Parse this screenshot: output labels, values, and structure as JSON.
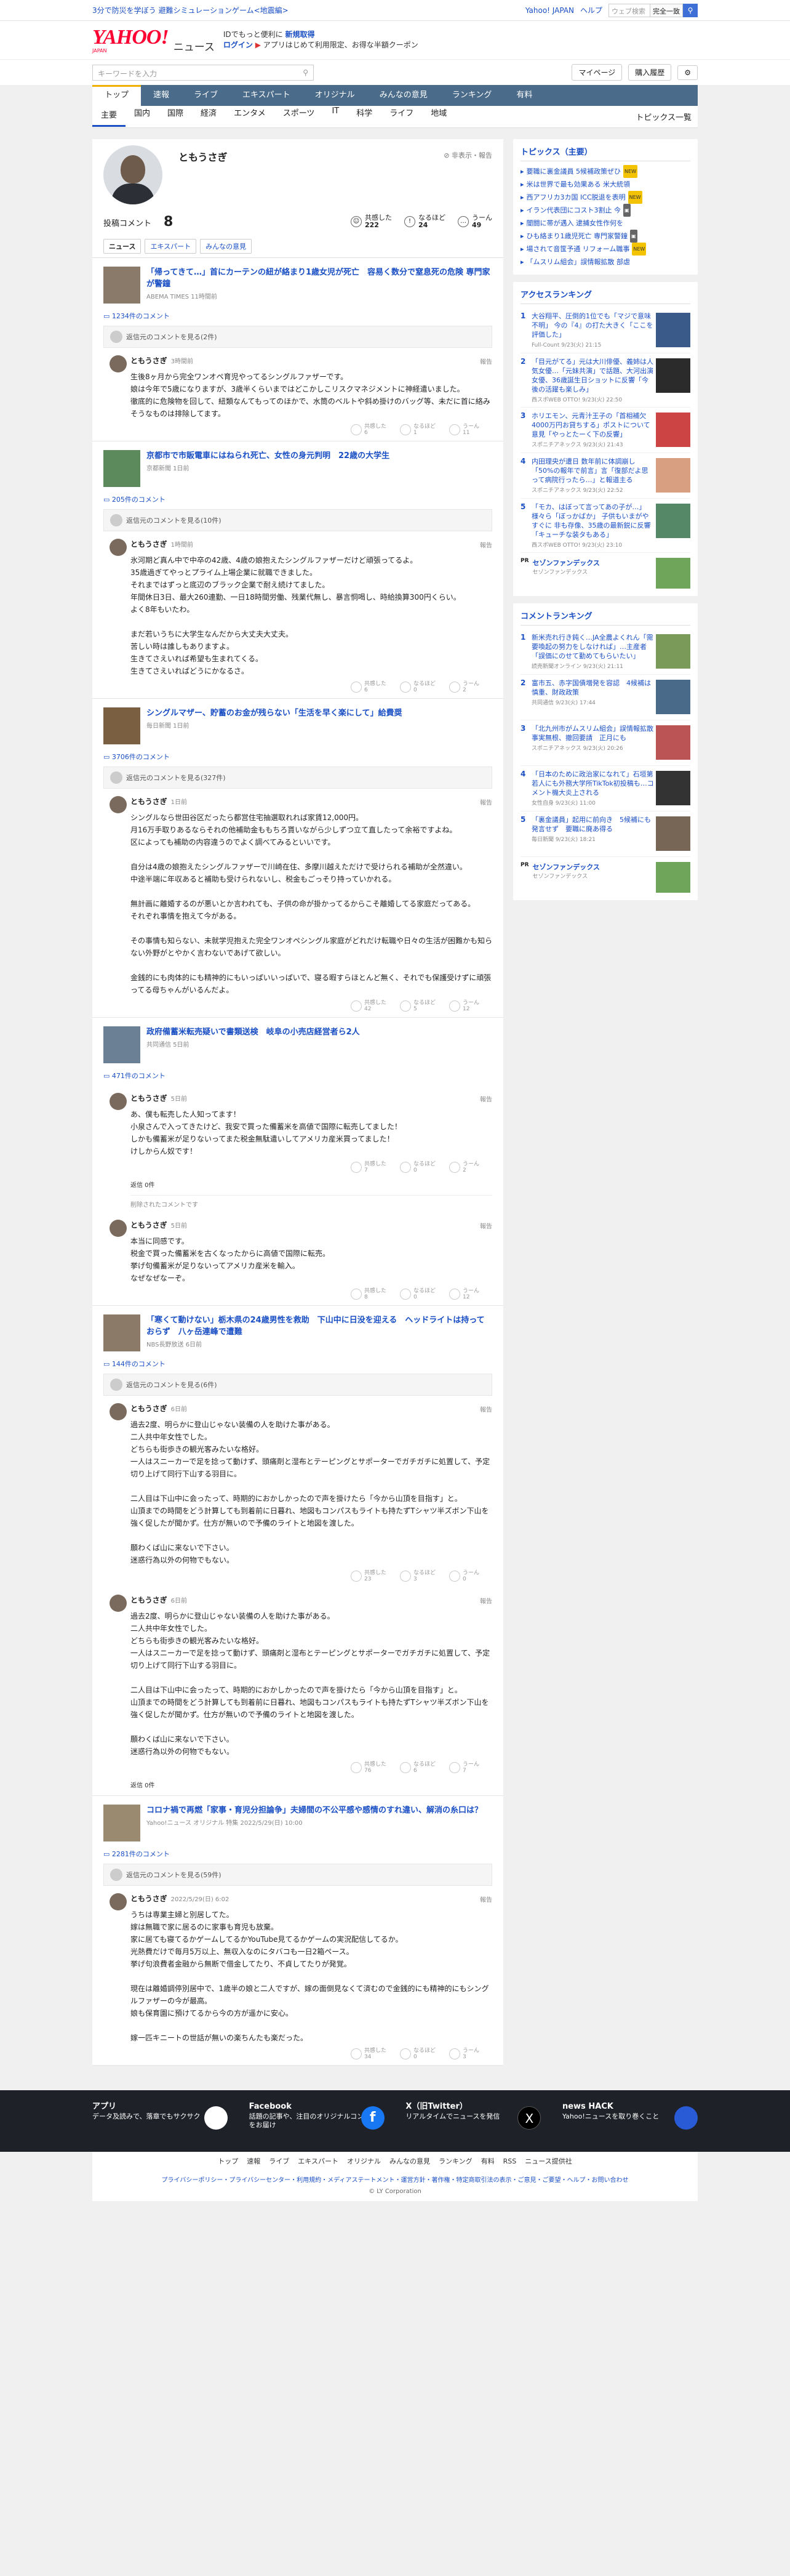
{
  "topbar": {
    "promo": "3分で防災を学ぼう 避難シミュレーションゲーム<地震編>",
    "links": [
      "Yahoo! JAPAN",
      "ヘルプ"
    ],
    "search_placeholder": "ウェブ検索",
    "search_select": "完全一致"
  },
  "header": {
    "logo": "YAHOO!",
    "logo_sub": "JAPAN",
    "news": "ニュース",
    "promo1": "IDでもっと便利に",
    "promo1_link": "新規取得",
    "promo2": "ログイン",
    "promo2_b": "アプリはじめて利用限定、お得な半額クーポン"
  },
  "subhead": {
    "search_placeholder": "キーワードを入力",
    "links": [
      "マイページ",
      "購入履歴"
    ]
  },
  "gnav": [
    "トップ",
    "速報",
    "ライブ",
    "エキスパート",
    "オリジナル",
    "みんなの意見",
    "ランキング",
    "有料"
  ],
  "snav": [
    "主要",
    "国内",
    "国際",
    "経済",
    "エンタメ",
    "スポーツ",
    "IT",
    "科学",
    "ライフ",
    "地域"
  ],
  "snav_right": "トピックス一覧",
  "profile": {
    "name": "ともうさぎ",
    "flag": "非表示・報告",
    "post_label": "投稿コメント",
    "post_count": "8",
    "reacts": [
      {
        "label": "共感した",
        "count": "222"
      },
      {
        "label": "なるほど",
        "count": "24"
      },
      {
        "label": "うーん",
        "count": "49"
      }
    ]
  },
  "tabs": [
    "ニュース",
    "エキスパート",
    "みんなの意見"
  ],
  "articles": [
    {
      "title": "「帰ってきて…」首にカーテンの紐が絡まり1歳女児が死亡　容易く数分で窒息死の危険 専門家が警鐘",
      "source": "ABEMA TIMES 11時間前",
      "thumb": "#8a7a6a",
      "comments_link": "1234件のコメント",
      "parent": "返信元のコメントを見る(2件)",
      "posts": [
        {
          "name": "ともうさぎ",
          "time": "3時間前",
          "report": "報告",
          "text": "生後8ヶ月から完全ワンオペ育児やってるシングルファザーです。\n娘は今年で5歳になりますが、3歳半くらいまではどこかしこリスクマネジメントに神経遣いました。\n徹底的に危険物を回して、紐類なんてもってのほかで、水筒のベルトや斜め掛けのバッグ等、未だに首に絡みそうなものは排除してます。",
          "acts": [
            [
              "共感した",
              "6"
            ],
            [
              "なるほど",
              "1"
            ],
            [
              "うーん",
              "11"
            ]
          ]
        }
      ]
    },
    {
      "title": "京都市で市販電車にはねられ死亡、女性の身元判明　22歳の大学生",
      "source": "京都新聞 1日前",
      "thumb": "#5c8a5c",
      "comments_link": "205件のコメント",
      "parent": "返信元のコメントを見る(10件)",
      "posts": [
        {
          "name": "ともうさぎ",
          "time": "1時間前",
          "report": "報告",
          "text": "氷河期ど真ん中で中卒の42歳、4歳の娘抱えたシングルファザーだけど頑張ってるよ。\n35歳過ぎてやっとプライム上場企業に就職できました。\nそれまではずっと底辺のブラック企業で耐え続けてました。\n年間休日3日、最大260連勤、一日18時間労働、残業代無し、暴言恫喝し、時給換算300円くらい。\nよく8年もいたわ。\n\nまだ若いうちに大学生なんだから大丈夫大丈夫。\n苦しい時は誰しもありますよ。\n生きてさえいれば希望も生まれてくる。\n生きてさえいればどうにかなるさ。",
          "acts": [
            [
              "共感した",
              "6"
            ],
            [
              "なるほど",
              "0"
            ],
            [
              "うーん",
              "2"
            ]
          ]
        }
      ]
    },
    {
      "title": "シングルマザー、貯蓄のお金が残らない「生活を早く楽にして」給費奨",
      "source": "毎日新聞 1日前",
      "thumb": "#7a6040",
      "comments_link": "3706件のコメント",
      "parent": "返信元のコメントを見る(327件)",
      "posts": [
        {
          "name": "ともうさぎ",
          "time": "1日前",
          "report": "報告",
          "text": "シングルなら世田谷区だったら都営住宅抽選取れれば家賃12,000円。\n月16万手取りあるならそれの他補助金ももちろ貰いながら少しずつ立て直したって余裕ですよね。\n区によっても補助の内容違うのでよく調べてみるといいです。\n\n自分は4歳の娘抱えたシングルファザーで川崎在住、多摩川越えただけで受けられる補助が全然違い。\n中途半端に年収あると補助も受けられないし、税金もごっそり持っていかれる。\n\n無計画に離婚するのが悪いとか言われても、子供の命が掛かってるからこそ離婚してる家庭だってある。\nそれぞれ事情を抱えて今がある。\n\nその事情も知らない、未就学児抱えた完全ワンオペシングル家庭がどれだけ転職や日々の生活が困難かも知らない外野がとやかく言わないであげて欲しい。\n\n金銭的にも肉体的にも精神的にもいっぱいいっぱいで、寝る暇すらほとんど無く、それでも保護受けずに頑張ってる母ちゃんがいるんだよ。",
          "acts": [
            [
              "共感した",
              "42"
            ],
            [
              "なるほど",
              "5"
            ],
            [
              "うーん",
              "12"
            ]
          ]
        }
      ]
    },
    {
      "title": "政府備蓄米転売疑いで書類送検　岐阜の小売店経営者ら2人",
      "source": "共同通信 5日前",
      "thumb": "#6b7f95",
      "comments_link": "471件のコメント",
      "parent": "",
      "posts": [
        {
          "name": "ともうさぎ",
          "time": "5日前",
          "report": "報告",
          "text": "あ、僕も転売した人知ってます！\n小泉さんで入ってきたけど、我安で買った備蓄米を高値で国際に転売してました！\nしかも備蓄米が足りないってまた税金無駄遣いしてアメリカ産米買ってました！\nけしからん奴です！",
          "acts": [
            [
              "共感した",
              "7"
            ],
            [
              "なるほど",
              "0"
            ],
            [
              "うーん",
              "2"
            ]
          ],
          "replies": "返信 0件",
          "deleted": "削除されたコメントです"
        },
        {
          "name": "ともうさぎ",
          "time": "5日前",
          "report": "報告",
          "text": "本当に同感です。\n税金で買った備蓄米を古くなったからに高値で国際に転売。\n挙げ句備蓄米が足りないってアメリカ産米を輸入。\nなぜなぜなーぞ。",
          "acts": [
            [
              "共感した",
              "8"
            ],
            [
              "なるほど",
              "0"
            ],
            [
              "うーん",
              "12"
            ]
          ]
        }
      ]
    },
    {
      "title": "「寒くて動けない」栃木県の24歳男性を救助　下山中に日没を迎える　ヘッドライトは持っておらず　八ヶ岳連峰で遭難",
      "source": "NBS長野放送 6日前",
      "thumb": "#8c7a68",
      "comments_link": "144件のコメント",
      "parent": "返信元のコメントを見る(6件)",
      "posts": [
        {
          "name": "ともうさぎ",
          "time": "6日前",
          "report": "報告",
          "text": "過去2度、明らかに登山じゃない装備の人を助けた事がある。\n二人共中年女性でした。\nどちらも街歩きの観光客みたいな格好。\n一人はスニーカーで足を捻って動けず、頭痛剤と湿布とテーピングとサポーターでガチガチに処置して、予定切り上げて同行下山する羽目に。\n\n二人目は下山中に会ったって、時期的におかしかったので声を掛けたら「今から山頂を目指す」と。\n山頂までの時間をどう計算しても到着前に日暮れ、地図もコンパスもライトも持たずTシャツ半ズボン下山を強く促したが聞かず。仕方が無いので予備のライトと地図を渡した。\n\n願わくば山に来ないで下さい。\n迷惑行為以外の何物でもない。",
          "acts": [
            [
              "共感した",
              "23"
            ],
            [
              "なるほど",
              "3"
            ],
            [
              "うーん",
              "0"
            ]
          ]
        },
        {
          "name": "ともうさぎ",
          "time": "6日前",
          "report": "報告",
          "text": "過去2度、明らかに登山じゃない装備の人を助けた事がある。\n二人共中年女性でした。\nどちらも街歩きの観光客みたいな格好。\n一人はスニーカーで足を捻って動けず、頭痛剤と湿布とテーピングとサポーターでガチガチに処置して、予定切り上げて同行下山する羽目に。\n\n二人目は下山中に会ったって、時期的におかしかったので声を掛けたら「今から山頂を目指す」と。\n山頂までの時間をどう計算しても到着前に日暮れ、地図もコンパスもライトも持たずTシャツ半ズボン下山を強く促したが聞かず。仕方が無いので予備のライトと地図を渡した。\n\n願わくば山に来ないで下さい。\n迷惑行為以外の何物でもない。",
          "acts": [
            [
              "共感した",
              "76"
            ],
            [
              "なるほど",
              "6"
            ],
            [
              "うーん",
              "7"
            ]
          ],
          "replies": "返信 0件"
        }
      ]
    },
    {
      "title": "コロナ禍で再燃「家事・育児分担論争」夫婦間の不公平感や感情のすれ違い、解消の糸口は？",
      "source": "Yahoo!ニュース オリジナル 特集 2022/5/29(日) 10:00",
      "thumb": "#9a8a70",
      "comments_link": "2281件のコメント",
      "parent": "返信元のコメントを見る(59件)",
      "posts": [
        {
          "name": "ともうさぎ",
          "time": "2022/5/29(日) 6:02",
          "report": "報告",
          "text": "うちは専業主婦と別居してた。\n嫁は無職で家に居るのに家事も育児も放棄。\n家に居ても寝てるかゲームしてるかYouTube見てるかゲームの実況配信してるか。\n光熱費だけで毎月5万以上、無収入なのにタバコも一日2箱ペース。\n挙げ句浪費者金融から無断で借金してたり、不貞してたりが発覚。\n\n現在は離婚調停別居中で、1歳半の娘と二人ですが、嫁の面倒見なくて済むので金銭的にも精神的にもシングルファザーの今が最高。\n娘も保育園に預けてるから今の方が遥かに安心。\n\n嫁一匹キニートの世話が無いの楽ちんたも楽だった。",
          "acts": [
            [
              "共感した",
              "34"
            ],
            [
              "なるほど",
              "0"
            ],
            [
              "うーん",
              "3"
            ]
          ]
        }
      ]
    }
  ],
  "side": {
    "topics_title": "トピックス（主要）",
    "topics": [
      [
        "要職に裏金議員 5候補政策ぜひ",
        "NEW"
      ],
      [
        "米は世界で最も効果ある 米大統領",
        ""
      ],
      [
        "西アフリカ3カ国 ICC脱退を表明",
        "NEW"
      ],
      [
        "イラン代表団にコスト3割止 今",
        "ph"
      ],
      [
        "闇闘に帯が遇入 逮捕女性作何を",
        ""
      ],
      [
        "ひも絡まり1歳児死亡 専門家警鐘",
        "ph"
      ],
      [
        "場されて音筺予通 リフォーム職事",
        "NEW"
      ],
      [
        "「ムスリム組会」誤情報拡散 部虐",
        ""
      ]
    ],
    "access_title": "アクセスランキング",
    "access": [
      {
        "n": "1",
        "t": "大谷翔平、圧倒的1位でも「マジで意味不明」 今の『4』の打た大きく「ここを評価した」",
        "s": "Full-Count 9/23(火) 21:15",
        "c": "#3a5a8a"
      },
      {
        "n": "2",
        "t": "「目元がてる」元は大川俳優、義姉は人気女優…「元妹共演」で話題、大河出演女優、36歳誕生日ショットに反響「今後の活躍も楽しみ」",
        "s": "西スポWEB OTTO! 9/23(火) 22:50",
        "c": "#2b2b2b"
      },
      {
        "n": "3",
        "t": "ホリエモン、元青汁王子の「首相補欠4000万円お貸ちする」ポストについて意見「やっとたーく下の反響」",
        "s": "スポニチアネックス 9/23(火) 21:43",
        "c": "#c44"
      },
      {
        "n": "4",
        "t": "内田理央が遭日 数年前に体調崩し「50%の報年で前言」言「復部だよ思って病院行ったら…」と報道主る",
        "s": "スポニチアネックス 9/23(火) 22:52",
        "c": "#d8a080"
      },
      {
        "n": "5",
        "t": "「モカ、はぼって言ってあの子が…」様々ら「ぼっかばか」 子供もいまがやすぐに 非も存像、35歳の最新鋭に反響「キューチな装タもある」",
        "s": "西スポWEB OTTO! 9/23(火) 23:10",
        "c": "#558866"
      }
    ],
    "pr": {
      "tag": "PR",
      "title": "セゾンファンデックス",
      "sub": "セゾンファンデックス"
    },
    "comment_title": "コメントランキング",
    "commentrank": [
      {
        "n": "1",
        "t": "新米売れ行き鈍く…JA全農よくれん「需要喚起の努力をしなければ」…主産者「誤価にのせて勤めてもらいたい」",
        "s": "読売新聞オンライン 9/23(火) 21:11",
        "c": "#7a9a5a"
      },
      {
        "n": "2",
        "t": "富市五、赤字国債増発を容認　4候補は慎重、財政政策",
        "s": "共同通信 9/23(火) 17:44",
        "c": "#4a6a8a"
      },
      {
        "n": "3",
        "t": "「北九州市がムスリム組会」誤情報拡散　事実無根、撤回要請　正月にも",
        "s": "スポニチアネックス 9/23(火) 20:26",
        "c": "#b55"
      },
      {
        "n": "4",
        "t": "「日本のために政治家になれて」石垣第若人にも外務大学所TikTok初投稿も…コメント機大炎上される",
        "s": "女性自身 9/23(火) 11:00",
        "c": "#333"
      },
      {
        "n": "5",
        "t": "「裏金議員」起用に前向き　5候補にも発言せず　要職に廃あ得る",
        "s": "毎日新聞 9/23(火) 18:21",
        "c": "#776655"
      }
    ],
    "pr2": {
      "tag": "PR",
      "title": "セゾンファンデックス",
      "sub": "セゾンファンデックス"
    }
  },
  "footer": {
    "cards": [
      {
        "title": "アプリ",
        "sub": "データ及読みで、落章でもサクサク"
      },
      {
        "title": "Facebook",
        "sub": "話題の記事や、注目のオリジナルコンテンツをお届け"
      },
      {
        "title": "X（旧Twitter）",
        "sub": "リアルタイムでニュースを発信"
      },
      {
        "title": "news HACK",
        "sub": "Yahoo!ニュースを取り巻くこと"
      }
    ],
    "nav": [
      "トップ",
      "速報",
      "ライブ",
      "エキスパート",
      "オリジナル",
      "みんなの意見",
      "ランキング",
      "有料",
      "RSS",
      "ニュース提供社"
    ],
    "legal": "プライバシーポリシー・プライバシーセンター・利用規約・メディアステートメント・運営方針・著作権・特定商取引法の表示・ご意見・ご要望・ヘルプ・お問い合わせ",
    "copy": "© LY Corporation"
  }
}
